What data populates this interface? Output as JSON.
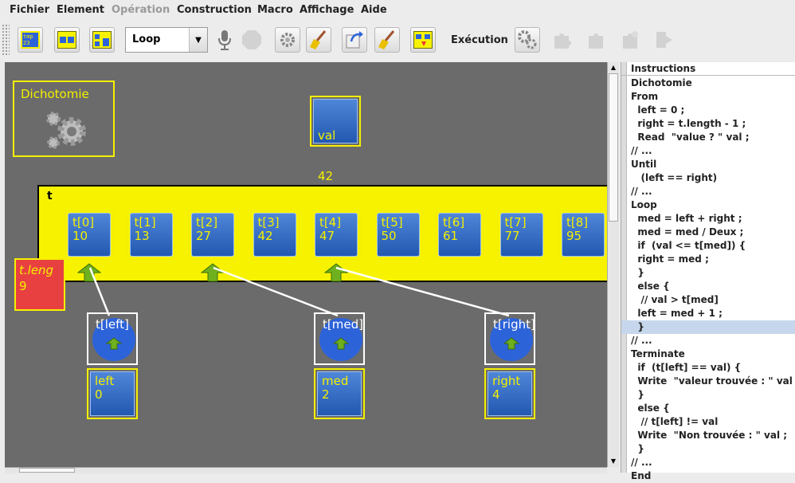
{
  "menu": {
    "fichier": "Fichier",
    "element": "Element",
    "operation": "Opération",
    "construction": "Construction",
    "macro": "Macro",
    "affichage": "Affichage",
    "aide": "Aide"
  },
  "toolbar": {
    "loop_select": "Loop",
    "execution_label": "Exécution",
    "tmp_icon_text": "tmp\n23"
  },
  "canvas": {
    "dichotomie_label": "Dichotomie",
    "val": {
      "name": "val",
      "value": "42"
    },
    "array": {
      "name": "t",
      "cells": [
        {
          "name": "t[0]",
          "value": "10"
        },
        {
          "name": "t[1]",
          "value": "13"
        },
        {
          "name": "t[2]",
          "value": "27"
        },
        {
          "name": "t[3]",
          "value": "42"
        },
        {
          "name": "t[4]",
          "value": "47"
        },
        {
          "name": "t[5]",
          "value": "50"
        },
        {
          "name": "t[6]",
          "value": "61"
        },
        {
          "name": "t[7]",
          "value": "77"
        },
        {
          "name": "t[8]",
          "value": "95"
        }
      ]
    },
    "tlength": {
      "name": "t.leng",
      "value": "9"
    },
    "pointers": [
      {
        "label": "t[left]",
        "var": "left",
        "value": "0"
      },
      {
        "label": "t[med]",
        "var": "med",
        "value": "2"
      },
      {
        "label": "t[right]",
        "var": "right",
        "value": "4"
      }
    ]
  },
  "instructions": {
    "title": "Instructions",
    "lines": [
      "Dichotomie",
      "From",
      "  left = 0 ;",
      "  right = t.length - 1 ;",
      "  Read  \"value ? \" val ;",
      "// ...",
      "Until",
      "   (left == right)",
      "// ...",
      "Loop",
      "  med = left + right ;",
      "  med = med / Deux ;",
      "  if  (val <= t[med]) {",
      "  right = med ;",
      "  }",
      "  else {",
      "   // val > t[med]",
      "  left = med + 1 ;",
      "  }",
      "// ...",
      "Terminate",
      "  if  (t[left] == val) {",
      "  Write  \"valeur trouvée : \" val",
      "  }",
      "  else {",
      "   // t[left] != val",
      "  Write  \"Non trouvée : \" val ;",
      "  }",
      "// ...",
      "End"
    ],
    "selected_line": "  }"
  },
  "colors": {
    "canvas_bg": "#6b6b6b",
    "highlight_yellow": "#f5f000",
    "cell_blue": "#2d63d9",
    "length_red": "#e84040",
    "selection": "#c6d6ec"
  }
}
